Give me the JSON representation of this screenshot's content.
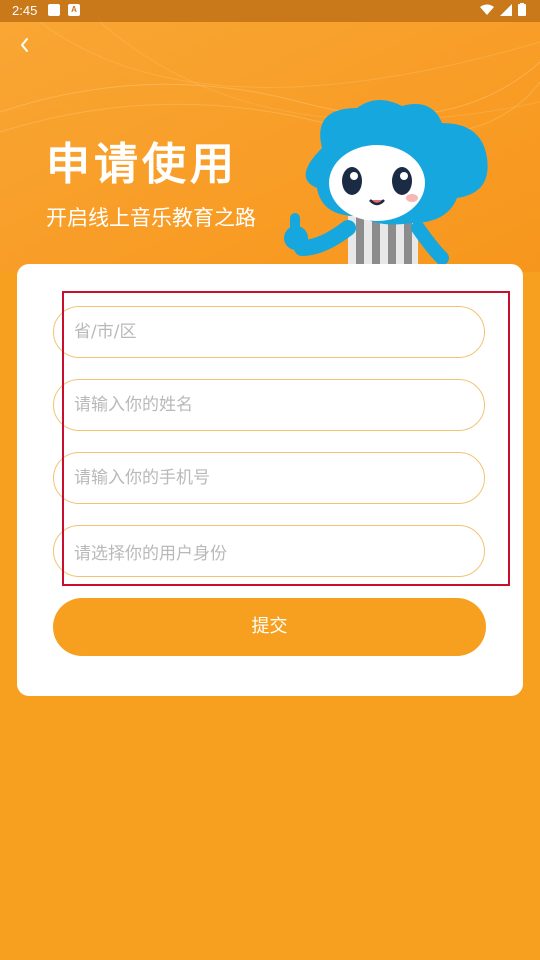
{
  "status_bar": {
    "time": "2:45"
  },
  "header": {
    "back_icon": "chevron-left-icon",
    "title": "申请使用",
    "subtitle": "开启线上音乐教育之路"
  },
  "form": {
    "region_placeholder": "省/市/区",
    "name_placeholder": "请输入你的姓名",
    "phone_placeholder": "请输入你的手机号",
    "identity_placeholder": "请选择你的用户身份",
    "submit_label": "提交"
  },
  "colors": {
    "background": "#F7A020",
    "status_bar": "#C9781A",
    "card": "#FFFFFF",
    "field_border": "#F2C472",
    "highlight": "#C8102E"
  }
}
